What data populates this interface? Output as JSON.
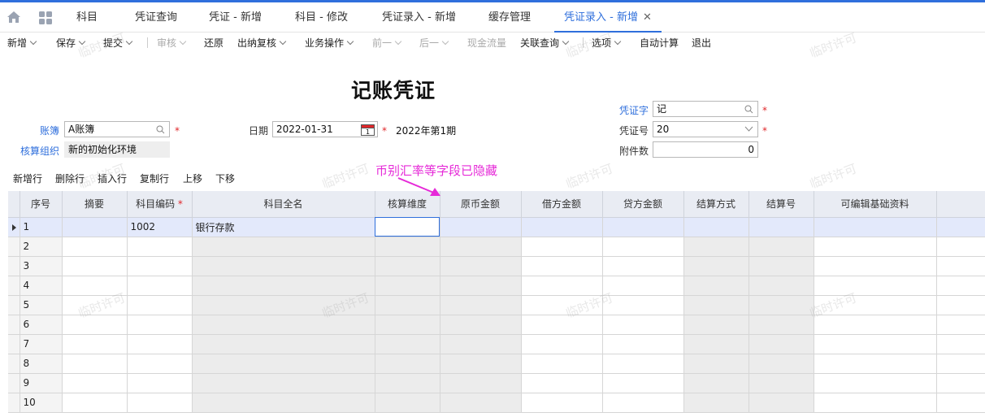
{
  "tabs": [
    {
      "label": "科目"
    },
    {
      "label": "凭证查询"
    },
    {
      "label": "凭证 - 新增"
    },
    {
      "label": "科目 - 修改"
    },
    {
      "label": "凭证录入 - 新增"
    },
    {
      "label": "缓存管理"
    },
    {
      "label": "凭证录入 - 新增",
      "close": "✕"
    }
  ],
  "toolbar": {
    "new": "新增",
    "save": "保存",
    "submit": "提交",
    "audit": "审核",
    "restore": "还原",
    "cashier_check": "出纳复核",
    "business_ops": "业务操作",
    "prev": "前一",
    "next": "后一",
    "cash_flow": "现金流量",
    "related_query": "关联查询",
    "options": "选项",
    "auto_calc": "自动计算",
    "exit": "退出"
  },
  "title": "记账凭证",
  "header": {
    "book_label": "账簿",
    "book_value": "A账簿",
    "org_label": "核算组织",
    "org_value": "新的初始化环境",
    "date_label": "日期",
    "date_value": "2022-01-31",
    "calendar_day": "1",
    "period": "2022年第1期",
    "voucher_word_label": "凭证字",
    "voucher_word_value": "记",
    "voucher_no_label": "凭证号",
    "voucher_no_value": "20",
    "attach_label": "附件数",
    "attach_value": "0",
    "required_mark": "*"
  },
  "row_actions": {
    "add_row": "新增行",
    "delete_row": "删除行",
    "insert_row": "插入行",
    "copy_row": "复制行",
    "move_up": "上移",
    "move_down": "下移"
  },
  "annotation": "币别汇率等字段已隐藏",
  "watermark": "临时许可",
  "grid": {
    "columns": [
      "序号",
      "摘要",
      "科目编码",
      "科目全名",
      "核算维度",
      "原币金额",
      "借方金额",
      "贷方金额",
      "结算方式",
      "结算号",
      "可编辑基础资料"
    ],
    "required_column_mark": "*",
    "rows": [
      {
        "seq": "1",
        "summary": "",
        "code": "1002",
        "name": "银行存款"
      },
      {
        "seq": "2",
        "summary": "",
        "code": "",
        "name": ""
      },
      {
        "seq": "3",
        "summary": "",
        "code": "",
        "name": ""
      },
      {
        "seq": "4",
        "summary": "",
        "code": "",
        "name": ""
      },
      {
        "seq": "5",
        "summary": "",
        "code": "",
        "name": ""
      },
      {
        "seq": "6",
        "summary": "",
        "code": "",
        "name": ""
      },
      {
        "seq": "7",
        "summary": "",
        "code": "",
        "name": ""
      },
      {
        "seq": "8",
        "summary": "",
        "code": "",
        "name": ""
      },
      {
        "seq": "9",
        "summary": "",
        "code": "",
        "name": ""
      },
      {
        "seq": "10",
        "summary": "",
        "code": "",
        "name": ""
      }
    ]
  },
  "colors": {
    "accent": "#2f6fdc",
    "required": "#e0262a",
    "annotation": "#e62ad8"
  }
}
